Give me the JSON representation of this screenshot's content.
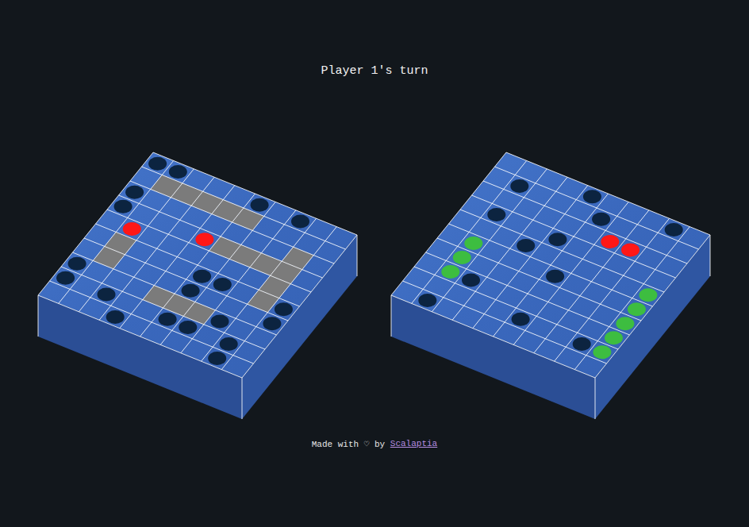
{
  "title": "Player 1's turn",
  "boards": [
    {
      "cells": [
        {
          "row": 0,
          "col": 0,
          "state": "miss"
        },
        {
          "row": 0,
          "col": 1,
          "state": "miss"
        },
        {
          "row": 2,
          "col": 0,
          "state": "miss"
        },
        {
          "row": 3,
          "col": 0,
          "state": "miss"
        },
        {
          "row": 7,
          "col": 0,
          "state": "miss"
        },
        {
          "row": 8,
          "col": 0,
          "state": "miss"
        },
        {
          "row": 8,
          "col": 2,
          "state": "miss"
        },
        {
          "row": 9,
          "col": 3,
          "state": "miss"
        },
        {
          "row": 0,
          "col": 5,
          "state": "miss"
        },
        {
          "row": 0,
          "col": 7,
          "state": "miss"
        },
        {
          "row": 5,
          "col": 5,
          "state": "miss"
        },
        {
          "row": 5,
          "col": 6,
          "state": "miss"
        },
        {
          "row": 6,
          "col": 5,
          "state": "miss"
        },
        {
          "row": 8,
          "col": 5,
          "state": "miss"
        },
        {
          "row": 8,
          "col": 6,
          "state": "miss"
        },
        {
          "row": 7,
          "col": 7,
          "state": "miss"
        },
        {
          "row": 8,
          "col": 8,
          "state": "miss"
        },
        {
          "row": 9,
          "col": 8,
          "state": "miss"
        },
        {
          "row": 6,
          "col": 9,
          "state": "miss"
        },
        {
          "row": 5,
          "col": 9,
          "state": "miss"
        },
        {
          "row": 4,
          "col": 1,
          "state": "hit"
        },
        {
          "row": 3,
          "col": 4,
          "state": "hit"
        },
        {
          "row": 1,
          "col": 1,
          "state": "ship"
        },
        {
          "row": 1,
          "col": 2,
          "state": "ship"
        },
        {
          "row": 1,
          "col": 3,
          "state": "ship"
        },
        {
          "row": 1,
          "col": 4,
          "state": "ship"
        },
        {
          "row": 1,
          "col": 5,
          "state": "ship"
        },
        {
          "row": 3,
          "col": 5,
          "state": "ship"
        },
        {
          "row": 3,
          "col": 6,
          "state": "ship"
        },
        {
          "row": 3,
          "col": 7,
          "state": "ship"
        },
        {
          "row": 2,
          "col": 8,
          "state": "ship"
        },
        {
          "row": 3,
          "col": 8,
          "state": "ship"
        },
        {
          "row": 4,
          "col": 8,
          "state": "ship"
        },
        {
          "row": 5,
          "col": 8,
          "state": "ship"
        },
        {
          "row": 5,
          "col": 1,
          "state": "ship"
        },
        {
          "row": 6,
          "col": 1,
          "state": "ship"
        },
        {
          "row": 7,
          "col": 4,
          "state": "ship"
        },
        {
          "row": 7,
          "col": 5,
          "state": "ship"
        },
        {
          "row": 7,
          "col": 6,
          "state": "ship"
        }
      ]
    },
    {
      "cells": [
        {
          "row": 1,
          "col": 1,
          "state": "miss"
        },
        {
          "row": 0,
          "col": 4,
          "state": "miss"
        },
        {
          "row": 3,
          "col": 1,
          "state": "miss"
        },
        {
          "row": 1,
          "col": 5,
          "state": "miss"
        },
        {
          "row": 0,
          "col": 8,
          "state": "miss"
        },
        {
          "row": 3,
          "col": 4,
          "state": "miss"
        },
        {
          "row": 4,
          "col": 3,
          "state": "miss"
        },
        {
          "row": 7,
          "col": 2,
          "state": "miss"
        },
        {
          "row": 5,
          "col": 5,
          "state": "miss"
        },
        {
          "row": 9,
          "col": 1,
          "state": "miss"
        },
        {
          "row": 8,
          "col": 5,
          "state": "miss"
        },
        {
          "row": 8,
          "col": 8,
          "state": "miss"
        },
        {
          "row": 2,
          "col": 6,
          "state": "hit"
        },
        {
          "row": 2,
          "col": 7,
          "state": "hit"
        },
        {
          "row": 5,
          "col": 1,
          "state": "sunk"
        },
        {
          "row": 6,
          "col": 1,
          "state": "sunk"
        },
        {
          "row": 7,
          "col": 1,
          "state": "sunk"
        },
        {
          "row": 4,
          "col": 9,
          "state": "sunk"
        },
        {
          "row": 5,
          "col": 9,
          "state": "sunk"
        },
        {
          "row": 6,
          "col": 9,
          "state": "sunk"
        },
        {
          "row": 7,
          "col": 9,
          "state": "sunk"
        },
        {
          "row": 8,
          "col": 9,
          "state": "sunk"
        }
      ]
    }
  ],
  "footer": {
    "text": "Made with ♡ by",
    "link": "Scalaptia"
  }
}
